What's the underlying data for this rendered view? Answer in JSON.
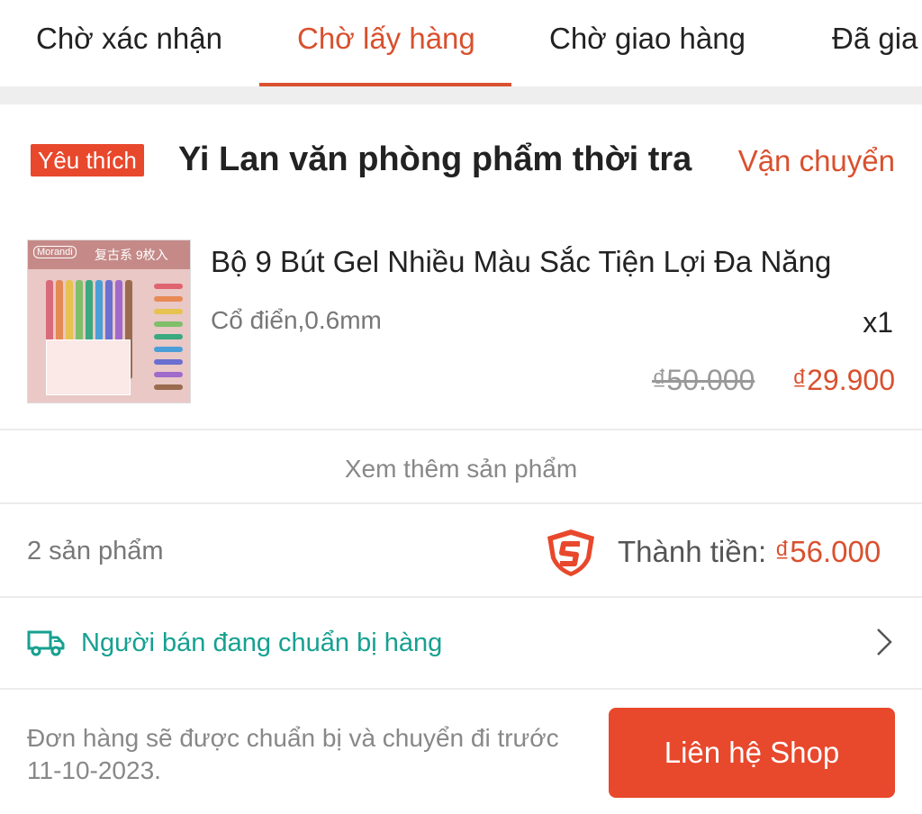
{
  "tabs": [
    {
      "label": "Chờ xác nhận",
      "active": false
    },
    {
      "label": "Chờ lấy hàng",
      "active": true
    },
    {
      "label": "Chờ giao hàng",
      "active": false
    },
    {
      "label": "Đã gia",
      "active": false
    }
  ],
  "shop": {
    "badge": "Yêu thích",
    "name": "Yi Lan văn phòng phẩm thời tra",
    "status": "Vận chuyển"
  },
  "product": {
    "thumbnail_brand": "Morandi",
    "thumbnail_label": "复古系 9枚入",
    "name": "Bộ 9 Bút Gel Nhiều Màu Sắc Tiện Lợi Đa Năng",
    "variant": "Cổ điển,0.6mm",
    "quantity": "x1",
    "original_price": "₫50.000",
    "sale_price": "₫29.900"
  },
  "more_products": "Xem thêm sản phẩm",
  "summary": {
    "count": "2 sản phẩm",
    "total_label": "Thành tiền:",
    "total_value": "₫56.000"
  },
  "shipping": {
    "message": "Người bán đang chuẩn bị hàng"
  },
  "footer": {
    "note": "Đơn hàng sẽ được chuẩn bị và chuyển đi trước 11-10-2023.",
    "contact_button": "Liên hệ Shop"
  },
  "colors": {
    "accent": "#d9502e",
    "button": "#e8482c",
    "shipping_text": "#16a091"
  },
  "icons": [
    "shield-icon",
    "truck-icon",
    "chevron-right-icon"
  ]
}
